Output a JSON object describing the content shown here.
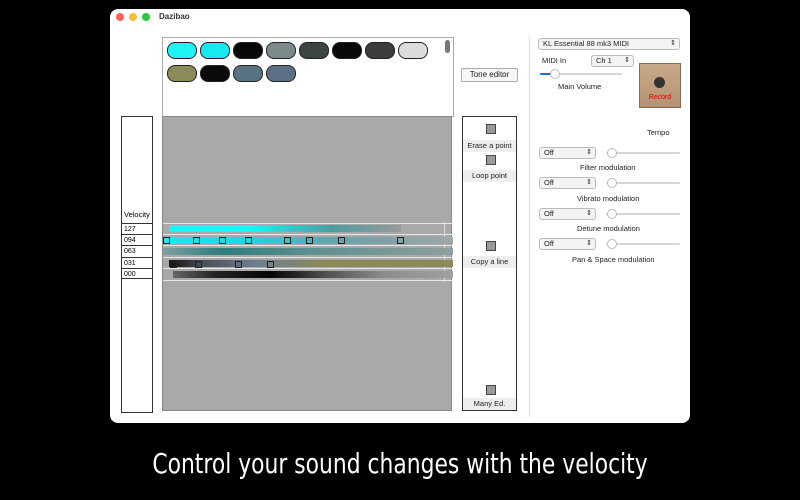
{
  "window": {
    "title": "Dazibao"
  },
  "palette": {
    "colors": [
      "#1ff2f2",
      "#16eaf0",
      "#080808",
      "#7b8b8b",
      "#3d4444",
      "#080808",
      "#3c3c3c",
      "#dcdcdc",
      "#8d8a5a",
      "#0a0a0a",
      "#5a7382",
      "#5c6f85"
    ]
  },
  "toolbar": {
    "tone_editor_label": "Tone editor"
  },
  "velocity": {
    "title": "Velocity",
    "rows": [
      "127",
      "094",
      "063",
      "031",
      "000"
    ]
  },
  "tools": {
    "erase_label": "Erase a point",
    "loop_label": "Loop point",
    "copy_label": "Copy a line",
    "many_label": "Many Ed."
  },
  "midi": {
    "device": "KL Essential 88 mk3 MIDI",
    "midi_in_label": "MIDI In",
    "channel": "Ch 1",
    "main_volume_label": "Main Volume",
    "record_label": "Record",
    "tempo_label": "Tempo"
  },
  "modulations": [
    {
      "value": "Off",
      "label": "Filter modulation"
    },
    {
      "value": "Off",
      "label": "Vibrato modulation"
    },
    {
      "value": "Off",
      "label": "Detune modulation"
    },
    {
      "value": "Off",
      "label": "Pan & Space modulation"
    }
  ],
  "caption": "Control your sound changes with the velocity"
}
